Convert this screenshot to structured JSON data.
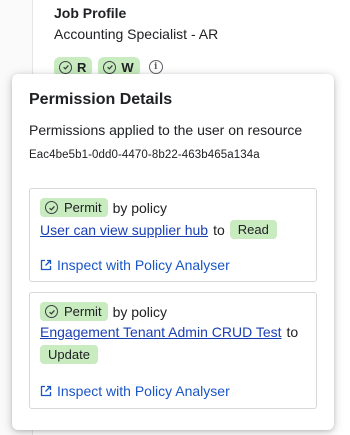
{
  "job_profile": {
    "label": "Job Profile",
    "value": "Accounting Specialist - AR",
    "permissions": [
      {
        "label": "R",
        "icon": "check-circle-icon"
      },
      {
        "label": "W",
        "icon": "check-circle-icon"
      }
    ],
    "info_icon": "info-icon"
  },
  "popover": {
    "title": "Permission Details",
    "description": "Permissions applied to the user on resource",
    "resource_id": "Eac4be5b1-0dd0-4470-8b22-463b465a134a",
    "entries": [
      {
        "effect": "Permit",
        "by_text": "by policy",
        "policy": "User can view supplier hub",
        "to_text": "to",
        "action": "Read",
        "inspect_label": "Inspect with Policy Analyser"
      },
      {
        "effect": "Permit",
        "by_text": "by policy",
        "policy": "Engagement Tenant Admin CRUD Test",
        "to_text": "to",
        "action": "Update",
        "inspect_label": "Inspect with Policy Analyser"
      }
    ]
  },
  "colors": {
    "chip_green": "#c8ebc0",
    "link_blue": "#1a3fb5"
  }
}
